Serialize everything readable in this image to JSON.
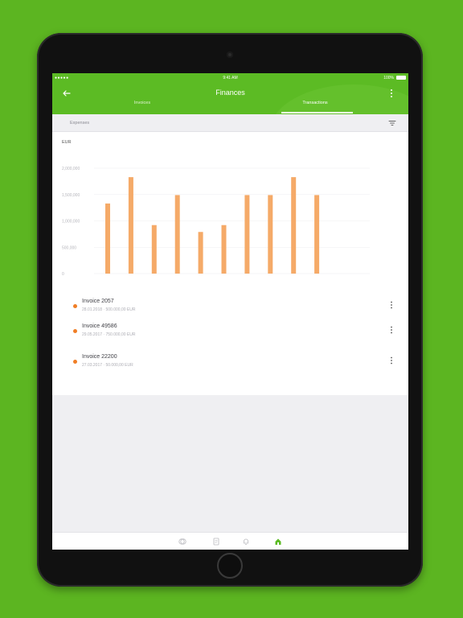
{
  "status": {
    "signal": "●●●●● ",
    "time": "9:41 AM",
    "battery": "100%"
  },
  "header": {
    "title": "Finances"
  },
  "tabs": [
    {
      "label": "Invoices",
      "active": false
    },
    {
      "label": "Transactions",
      "active": true
    }
  ],
  "filter": {
    "label": "Expenses"
  },
  "colors": {
    "brand": "#5cbb24",
    "bar": "#f5aa68",
    "dot": "#f07e26",
    "background": "#5cb521"
  },
  "chart_data": {
    "type": "bar",
    "ylabel": "EUR",
    "yticks": [
      "2,000,000",
      "1,500,000",
      "1,000,000",
      "500,000",
      "0"
    ],
    "ylim": [
      0,
      2000000
    ],
    "grid": true,
    "values": [
      1330000,
      1830000,
      920000,
      1490000,
      790000,
      920000,
      1490000,
      1490000,
      1830000,
      1490000
    ]
  },
  "transactions": [
    {
      "name": "Invoice 2057",
      "date": "28.01.2018",
      "amount": "500.000,00 EUR"
    },
    {
      "name": "Invoice 49586",
      "date": "29.05.2017",
      "amount": "750.000,00 EUR"
    },
    {
      "name": "Invoice 22200",
      "date": "27.03.2017",
      "amount": "50.000,00 EUR"
    }
  ],
  "bottom_nav": [
    {
      "icon": "finance-icon",
      "active": false
    },
    {
      "icon": "documents-icon",
      "active": false
    },
    {
      "icon": "bell-icon",
      "active": false
    },
    {
      "icon": "home-icon",
      "active": true
    }
  ]
}
